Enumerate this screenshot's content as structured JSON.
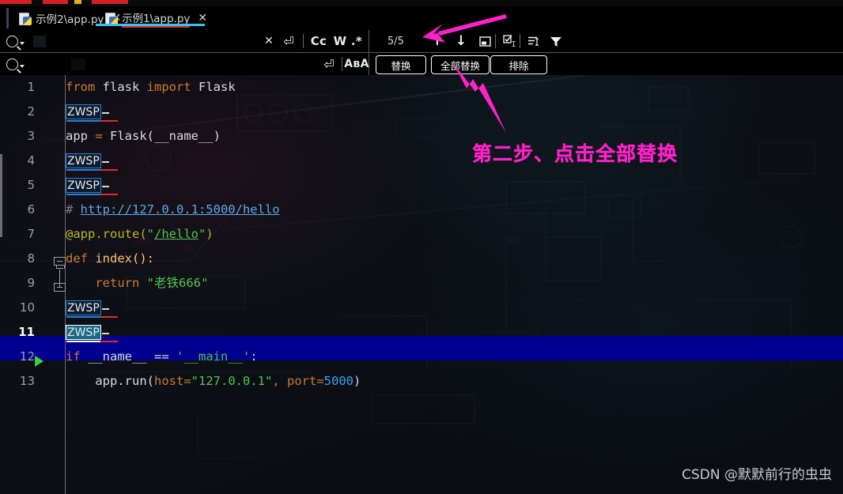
{
  "window": {
    "top_strip_note": "truncated toolbar strip"
  },
  "tabs": [
    {
      "label": "示例2\\app.py",
      "icon": "python-file-icon",
      "close": "✕",
      "active": false
    },
    {
      "label": "示例1\\app.py",
      "icon": "python-file-icon",
      "close": "✕",
      "active": true
    }
  ],
  "find_panel": {
    "search": {
      "icon": "search-icon",
      "value": "",
      "placeholder": "",
      "clear_icon": "✕",
      "multiline_icon": "⏎",
      "match_case": "Cc",
      "whole_words": "W",
      "regex": ".*"
    },
    "replace": {
      "icon": "search-icon",
      "value": "",
      "placeholder": "",
      "multiline_icon": "⏎",
      "preserve_case": "AʙA"
    },
    "match_counter": "5/5",
    "prev_icon": "arrow-up-icon",
    "next_icon": "arrow-down-icon",
    "open_in_window_icon": "open-in-new-window-icon",
    "select_all_icon": "select-all-occurrences-icon",
    "in_selection_icon": "search-in-selection-icon",
    "filter_icon": "filter-icon",
    "buttons": [
      {
        "label": "替换",
        "name": "replace-button"
      },
      {
        "label": "全部替换",
        "name": "replace-all-button"
      },
      {
        "label": "排除",
        "name": "exclude-button"
      }
    ]
  },
  "editor": {
    "current_line": 11,
    "run_marker_line": 12,
    "zwsp_label": "ZWSP",
    "lines": [
      {
        "n": 1,
        "type": "code"
      },
      {
        "n": 2,
        "type": "zwsp",
        "selected": false
      },
      {
        "n": 3,
        "type": "code"
      },
      {
        "n": 4,
        "type": "zwsp",
        "selected": false
      },
      {
        "n": 5,
        "type": "zwsp",
        "selected": false
      },
      {
        "n": 6,
        "type": "code"
      },
      {
        "n": 7,
        "type": "code"
      },
      {
        "n": 8,
        "type": "code"
      },
      {
        "n": 9,
        "type": "code"
      },
      {
        "n": 10,
        "type": "zwsp",
        "selected": false
      },
      {
        "n": 11,
        "type": "zwsp",
        "selected": true
      },
      {
        "n": 12,
        "type": "code"
      },
      {
        "n": 13,
        "type": "code"
      }
    ],
    "code": {
      "l1_kw_from": "from",
      "l1_mod": " flask ",
      "l1_kw_import": "import",
      "l1_cls": " Flask",
      "l3_app": "app ",
      "l3_eq": "= ",
      "l3_flask": "Flask(__name__)",
      "l6_hash": "# ",
      "l6_url": "http://127.0.0.1:5000/hello",
      "l7_deco": "@app.route(",
      "l7_q1": "\"",
      "l7_path": "/hello",
      "l7_q2": "\"",
      "l7_close": ")",
      "l8_kw": "def",
      "l8_name": " index():",
      "l9_kw": "    return ",
      "l9_str": "\"老铁666\"",
      "l12_kw": "if",
      "l12_mid": " __name__ == ",
      "l12_str": "'__main__'",
      "l12_colon": ":",
      "l13_call": "    app.run(",
      "l13_host": "host",
      "l13_eq1": "=",
      "l13_hoststr": "\"127.0.0.1\"",
      "l13_comma": ", ",
      "l13_port": "port",
      "l13_eq2": "=",
      "l13_portnum": "5000",
      "l13_close": ")"
    }
  },
  "annotation": {
    "step_text": "第二步、点击全部替换",
    "arrow_color": "#ff22c8"
  },
  "watermark": "CSDN @默默前行的虫虫"
}
